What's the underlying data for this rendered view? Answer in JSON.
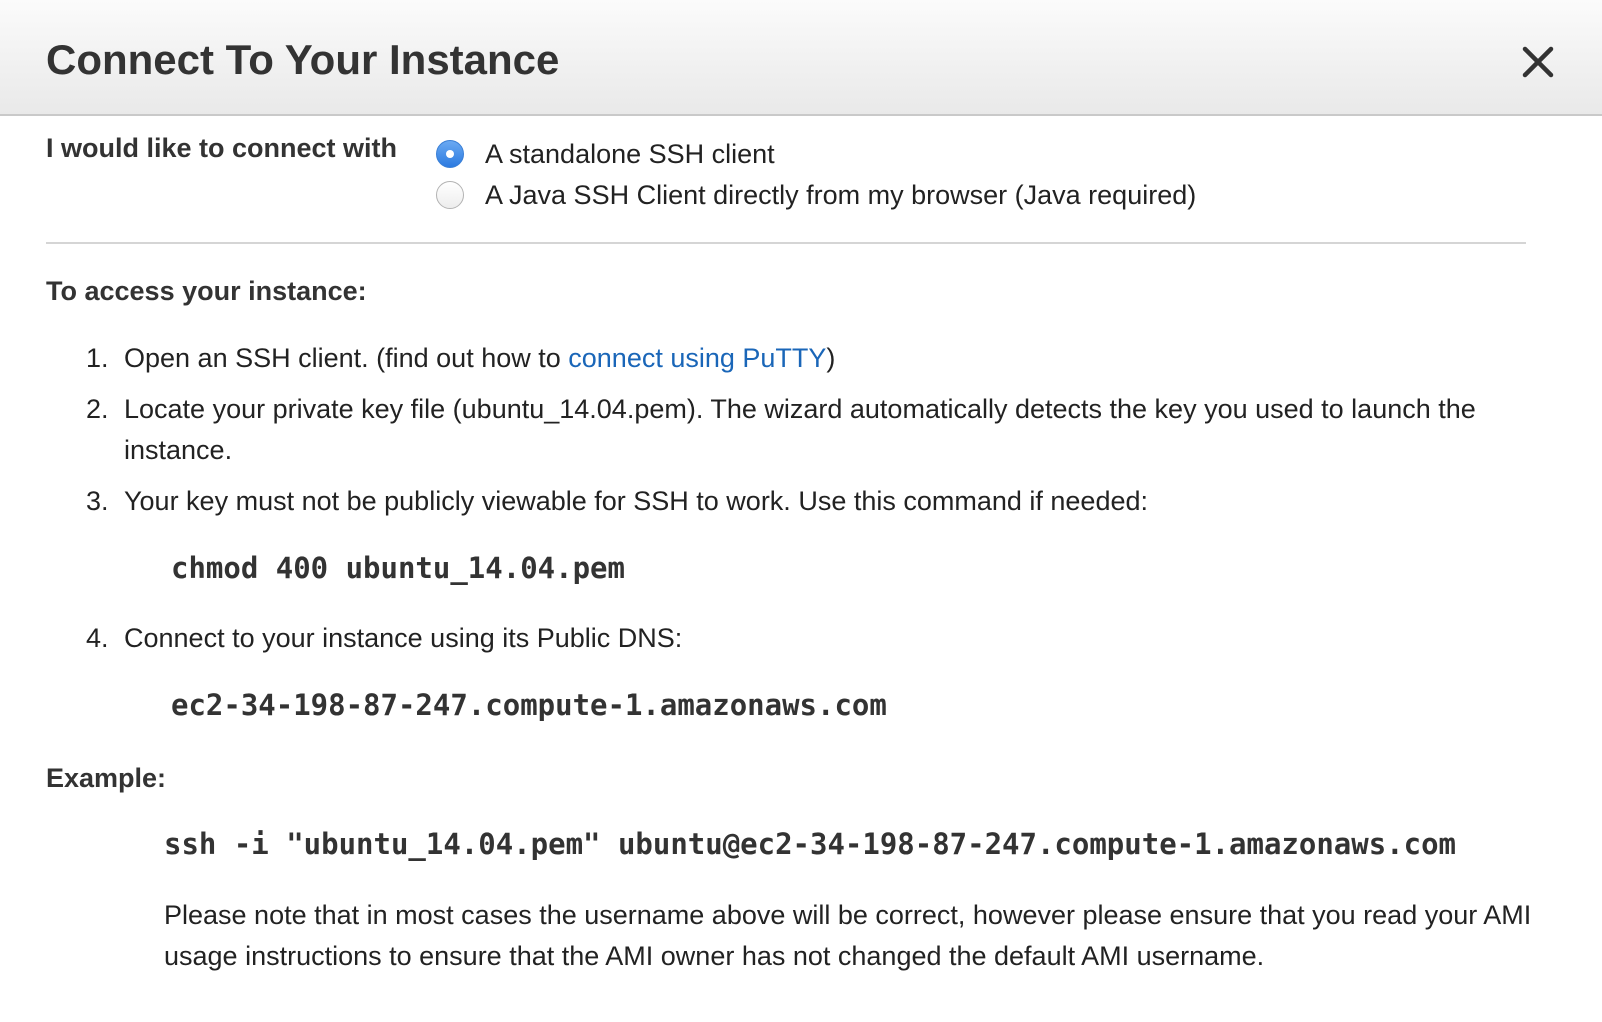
{
  "dialog": {
    "title": "Connect To Your Instance",
    "close_icon": "close-icon"
  },
  "connect_with": {
    "label": "I would like to connect with",
    "options": [
      {
        "label": "A standalone SSH client",
        "selected": true
      },
      {
        "label": "A Java SSH Client directly from my browser (Java required)",
        "selected": false
      }
    ]
  },
  "access": {
    "heading": "To access your instance:",
    "steps": [
      {
        "number": "1.",
        "text_before": "Open an SSH client. (find out how to",
        "link": "connect using PuTTY",
        "text_after": ")"
      },
      {
        "number": "2.",
        "text": "Locate your private key file (ubuntu_14.04.pem). The wizard automatically detects the key you used to launch the instance."
      },
      {
        "number": "3.",
        "text": "Your key must not be publicly viewable for SSH to work. Use this command if needed:",
        "command": "chmod 400 ubuntu_14.04.pem"
      },
      {
        "number": "4.",
        "text": "Connect to your instance using its Public DNS:",
        "command": "ec2-34-198-87-247.compute-1.amazonaws.com"
      }
    ]
  },
  "example": {
    "heading": "Example:",
    "command": "ssh -i \"ubuntu_14.04.pem\" ubuntu@ec2-34-198-87-247.compute-1.amazonaws.com",
    "note": "Please note that in most cases the username above will be correct, however please ensure that you read your AMI usage instructions to ensure that the AMI owner has not changed the default AMI username."
  },
  "colors": {
    "link": "#1a66b8",
    "radio_selected": "#2b7ae0",
    "header_bg": "#efefef"
  }
}
